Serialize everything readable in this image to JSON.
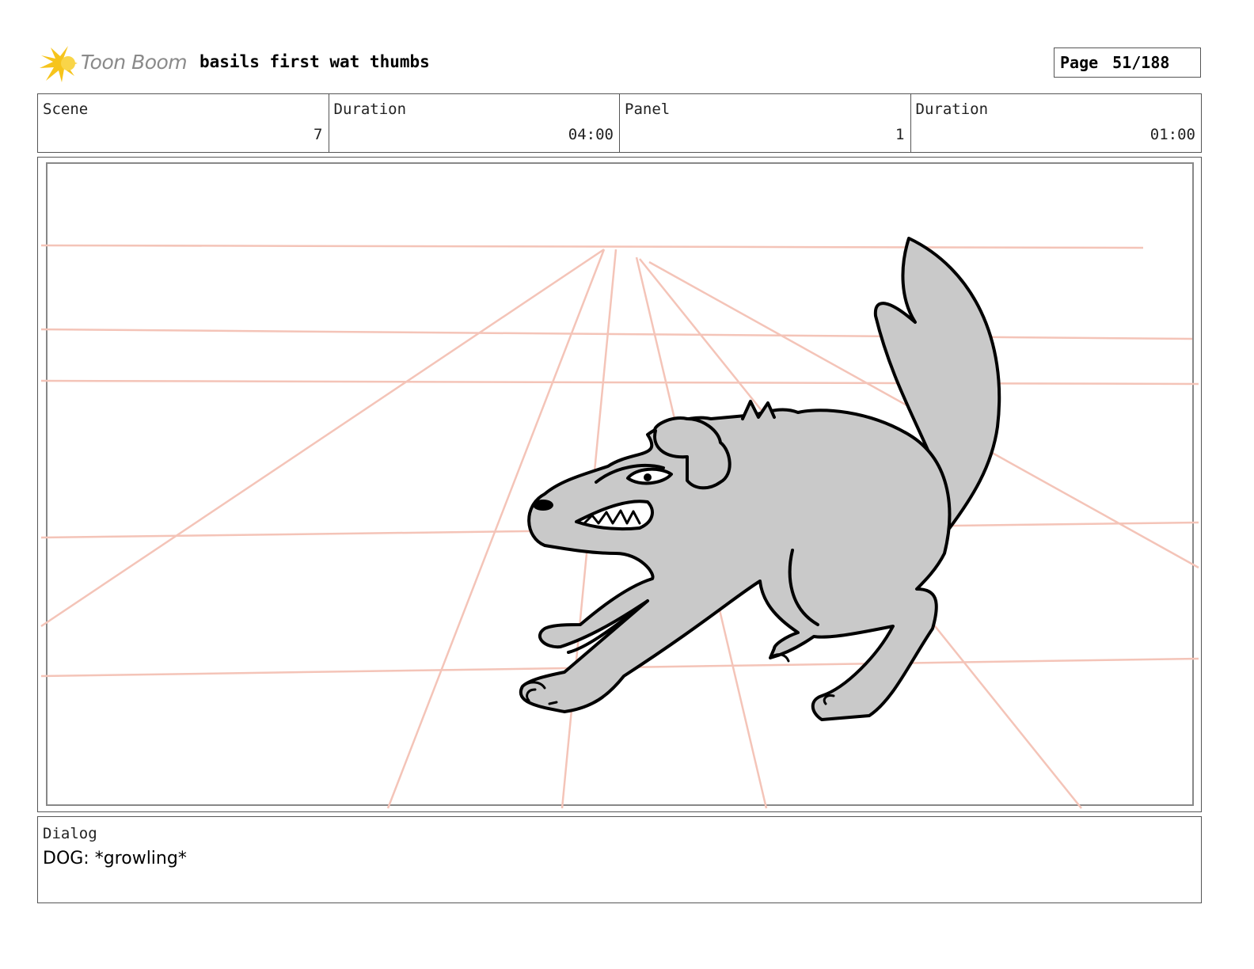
{
  "header": {
    "logo_text": "Toon Boom",
    "title": "basils first wat thumbs",
    "page_label": "Page",
    "page_number": "51/188"
  },
  "info": {
    "scene_label": "Scene",
    "scene_value": "7",
    "scene_duration_label": "Duration",
    "scene_duration_value": "04:00",
    "panel_label": "Panel",
    "panel_value": "1",
    "panel_duration_label": "Duration",
    "panel_duration_value": "01:00"
  },
  "dialog": {
    "label": "Dialog",
    "text": "DOG: *growling*"
  },
  "colors": {
    "logo_yellow": "#f6c41c",
    "guide_lines": "#f4c4b8",
    "dog_fill": "#c9c9c9",
    "frame": "#555555"
  }
}
